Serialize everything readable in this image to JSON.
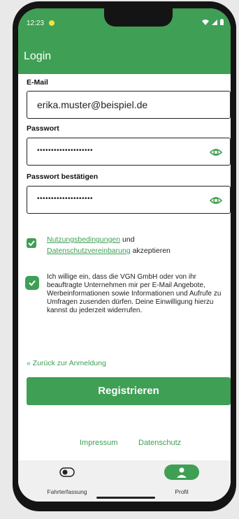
{
  "status": {
    "time": "12:23",
    "icons": "wifi signal battery"
  },
  "appbar": {
    "title": "Login"
  },
  "form": {
    "email_label": "E-Mail",
    "email_value": "erika.muster@beispiel.de",
    "password_label": "Passwort",
    "password_value": "••••••••••••••••••••",
    "password_confirm_label": "Passwort bestätigen",
    "password_confirm_value": "••••••••••••••••••••"
  },
  "terms": {
    "link1": "Nutzungsbedingungen",
    "and": "und",
    "link2": "Datenschutzvereinbarung",
    "accept": "akzeptieren",
    "checked": true
  },
  "consent": {
    "text": "Ich willige ein, dass die VGN GmbH oder von ihr beauftragte Unternehmen mir per E-Mail Angebote, Werbeinformationen sowie Informationen und Aufrufe zu Umfragen zusenden dürfen. Deine Einwilligung hierzu kannst du jederzeit widerrufen.",
    "checked": true
  },
  "back_link": "« Zurück zur Anmeldung",
  "register_button": "Registrieren",
  "footer": {
    "impressum": "Impressum",
    "datenschutz": "Datenschutz"
  },
  "nav": {
    "items": [
      {
        "label": "Fahrterfassung",
        "icon": "toggle-icon"
      },
      {
        "label": "Profil",
        "icon": "person-icon",
        "active": true
      }
    ]
  },
  "colors": {
    "accent": "#3f9f55"
  }
}
